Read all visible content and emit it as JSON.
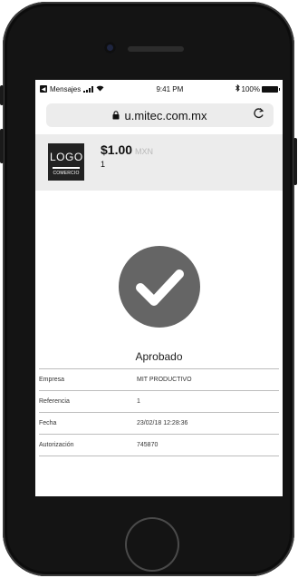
{
  "status_bar": {
    "carrier": "Mensajes",
    "time": "9:41 PM",
    "bluetooth": "bluetooth-icon",
    "battery": "100%"
  },
  "browser": {
    "url": "u.mitec.com.mx",
    "lock_icon": "lock-icon",
    "reload_icon": "reload-icon"
  },
  "merchant": {
    "logo_text": "LOGO",
    "logo_subtext": "COMERCIO",
    "amount": "$1.00",
    "currency": "MXN",
    "reference": "1"
  },
  "result": {
    "icon": "check-icon",
    "status": "Aprobado"
  },
  "details": [
    {
      "label": "Empresa",
      "value": "MIT PRODUCTIVO"
    },
    {
      "label": "Referencia",
      "value": "1"
    },
    {
      "label": "Fecha",
      "value": "23/02/18  12:28:36"
    },
    {
      "label": "Autorización",
      "value": "745870"
    }
  ],
  "colors": {
    "phone_body": "#141414",
    "check_circle": "#656565",
    "header_bg": "#ececec"
  }
}
